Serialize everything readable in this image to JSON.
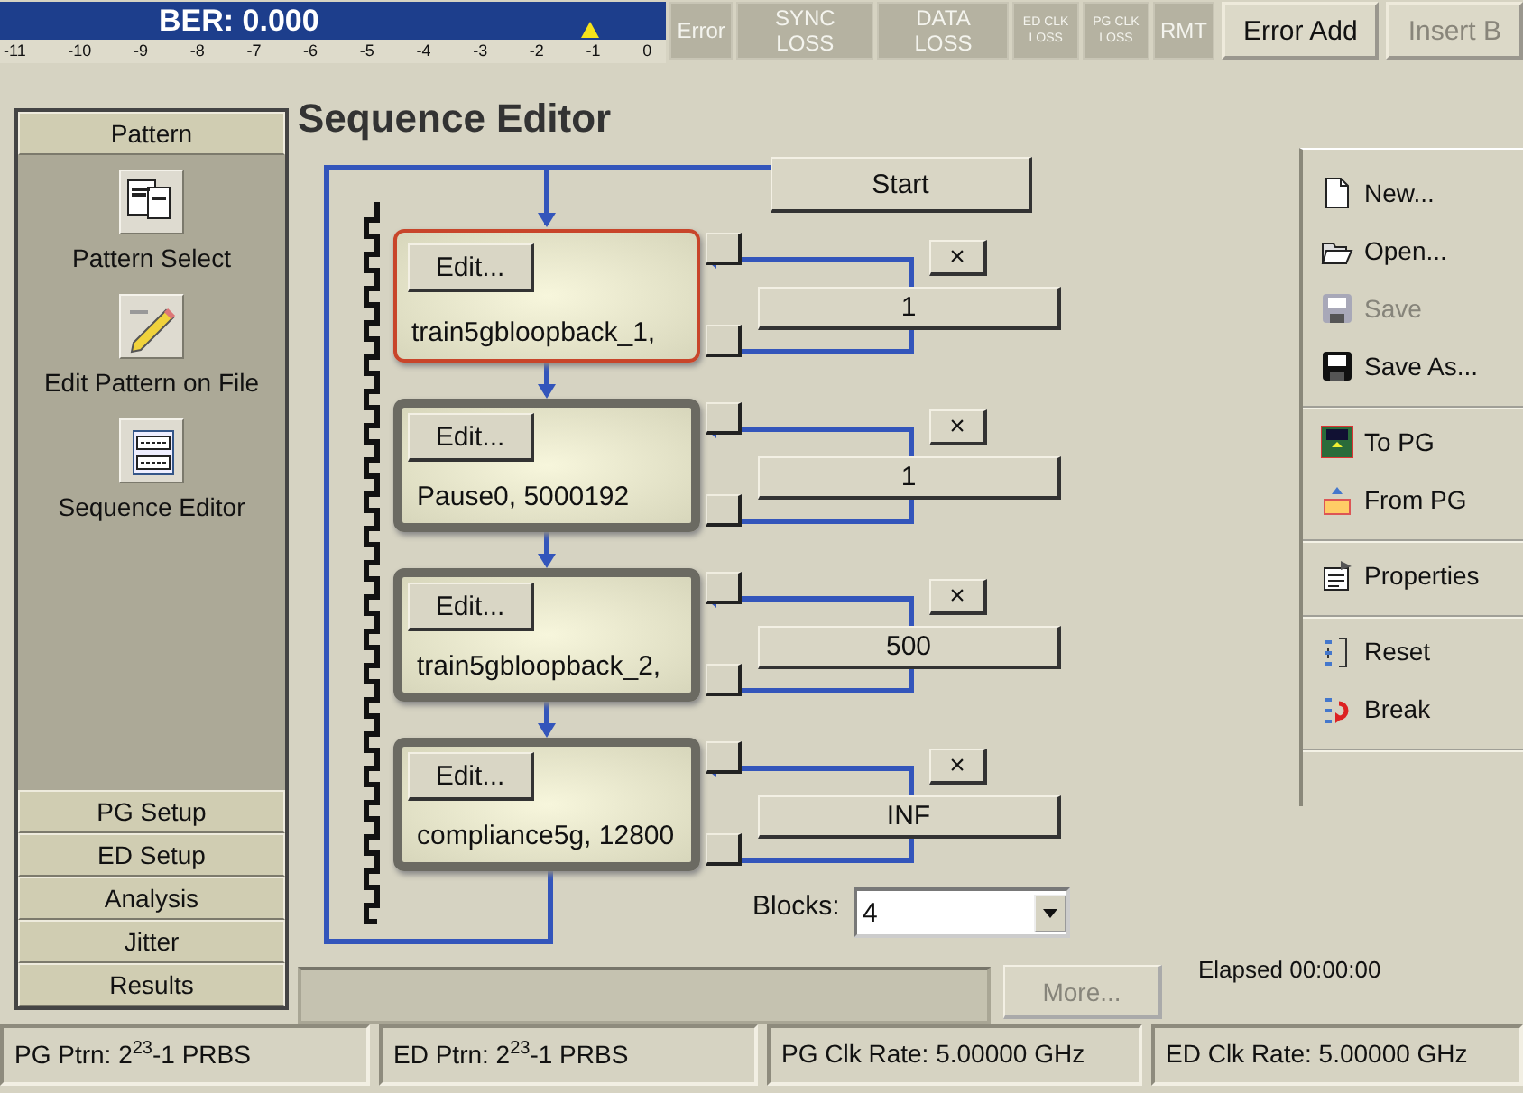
{
  "ber": {
    "label": "BER: 0.000",
    "level": 0.909,
    "scale": [
      "-11",
      "-10",
      "-9",
      "-8",
      "-7",
      "-6",
      "-5",
      "-4",
      "-3",
      "-2",
      "-1",
      "0"
    ]
  },
  "indicators": [
    {
      "label": "Error",
      "kind": "normal"
    },
    {
      "label": "SYNC LOSS",
      "kind": "normal"
    },
    {
      "label": "DATA LOSS",
      "kind": "normal"
    },
    {
      "label": "ED CLK LOSS",
      "kind": "small"
    },
    {
      "label": "PG CLK LOSS",
      "kind": "small"
    },
    {
      "label": "RMT",
      "kind": "normal"
    }
  ],
  "top_buttons": [
    {
      "label": "Error Add",
      "disabled": false
    },
    {
      "label": "Insert B",
      "disabled": true
    }
  ],
  "sidebar": {
    "header": "Pattern",
    "items": [
      {
        "label": "Pattern Select",
        "kind": "pages"
      },
      {
        "label": "Edit Pattern on File",
        "kind": "pencil"
      },
      {
        "label": "Sequence Editor",
        "kind": "sequence"
      }
    ],
    "tabs": [
      "PG Setup",
      "ED Setup",
      "Analysis",
      "Jitter",
      "Results"
    ]
  },
  "title": "Sequence Editor",
  "sequence": {
    "start": "Start",
    "blocks": [
      {
        "edit": "Edit...",
        "name": "train5gbloopback_1,",
        "selected": true,
        "delete": "×",
        "count": "1"
      },
      {
        "edit": "Edit...",
        "name": "Pause0, 5000192",
        "selected": false,
        "delete": "×",
        "count": "1"
      },
      {
        "edit": "Edit...",
        "name": "train5gbloopback_2,",
        "selected": false,
        "delete": "×",
        "count": "500"
      },
      {
        "edit": "Edit...",
        "name": "compliance5g, 12800",
        "selected": false,
        "delete": "×",
        "count": "INF"
      }
    ],
    "blocks_label": "Blocks:",
    "blocks_value": "4"
  },
  "toolbar": [
    [
      {
        "label": "New...",
        "kind": "new",
        "disabled": false
      },
      {
        "label": "Open...",
        "kind": "open",
        "disabled": false
      },
      {
        "label": "Save",
        "kind": "save",
        "disabled": true
      },
      {
        "label": "Save As...",
        "kind": "save",
        "disabled": false
      }
    ],
    [
      {
        "label": "To PG",
        "kind": "to-pg",
        "disabled": false
      },
      {
        "label": "From PG",
        "kind": "from-pg",
        "disabled": false
      }
    ],
    [
      {
        "label": "Properties",
        "kind": "properties",
        "disabled": false
      }
    ],
    [
      {
        "label": "Reset",
        "kind": "reset",
        "disabled": false
      },
      {
        "label": "Break",
        "kind": "break",
        "disabled": false
      }
    ]
  ],
  "message": {
    "more": "More...",
    "more_disabled": true,
    "elapsed": "Elapsed 00:00:00"
  },
  "status_bar": [
    "PG Ptrn: 2$^{23}$-1 PRBS",
    "ED Ptrn: 2$^{23}$-1 PRBS",
    "PG Clk Rate: 5.00000 GHz",
    "ED Clk Rate: 5.00000 GHz"
  ]
}
